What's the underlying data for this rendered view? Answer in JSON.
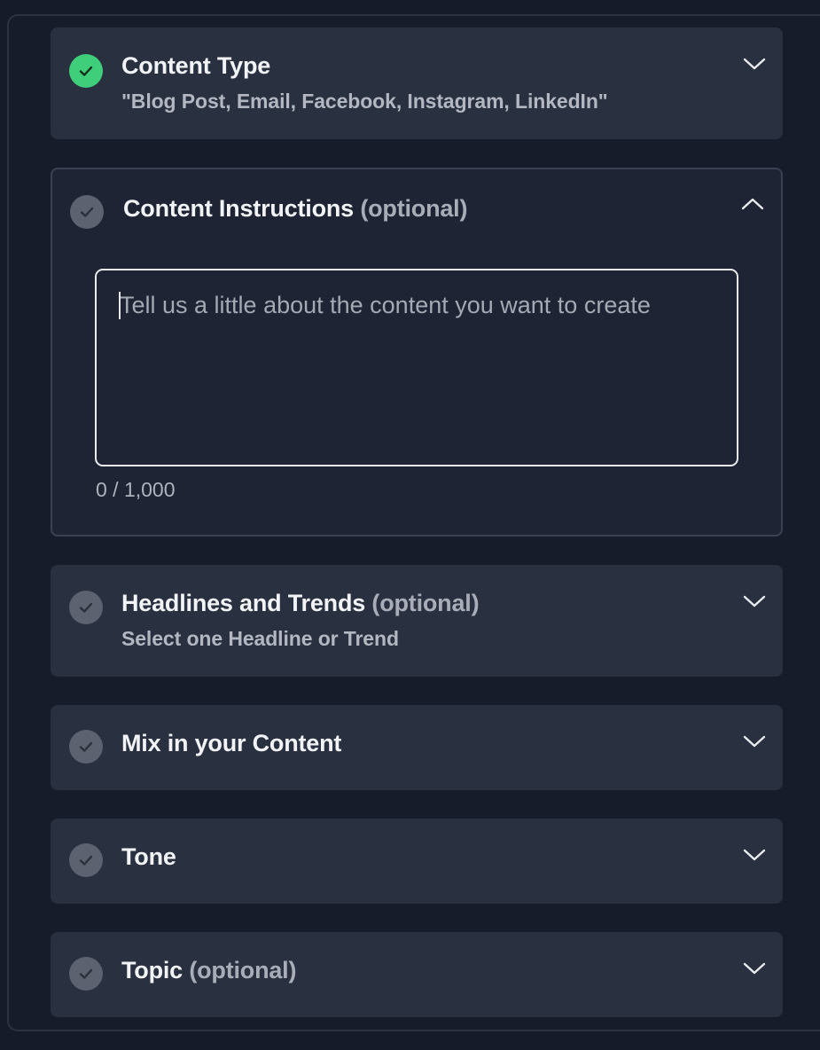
{
  "sections": {
    "content_type": {
      "title": "Content Type",
      "subtitle": "\"Blog Post, Email, Facebook, Instagram, LinkedIn\"",
      "status": "complete",
      "expanded": false
    },
    "content_instructions": {
      "title": "Content Instructions",
      "optional": "(optional)",
      "placeholder": "Tell us a little about the content you want to create",
      "value": "",
      "counter": "0 / 1,000",
      "status": "incomplete",
      "expanded": true
    },
    "headlines": {
      "title": "Headlines and Trends",
      "optional": "(optional)",
      "subtitle": "Select one Headline or Trend",
      "status": "incomplete",
      "expanded": false
    },
    "mix": {
      "title": "Mix in your Content",
      "status": "incomplete",
      "expanded": false
    },
    "tone": {
      "title": "Tone",
      "status": "incomplete",
      "expanded": false
    },
    "topic": {
      "title": "Topic",
      "optional": "(optional)",
      "status": "incomplete",
      "expanded": false
    }
  },
  "icons": {
    "status_complete": "check-circle-green-icon",
    "status_incomplete": "check-circle-gray-icon",
    "expand": "chevron-down-icon",
    "collapse": "chevron-up-icon"
  },
  "colors": {
    "background": "#151b29",
    "card": "#293040",
    "card_open": "#1e2433",
    "complete_green": "#3fce79",
    "incomplete_gray": "#5c6270",
    "text_primary": "#f1f3f6",
    "text_muted": "#a8adb8"
  }
}
